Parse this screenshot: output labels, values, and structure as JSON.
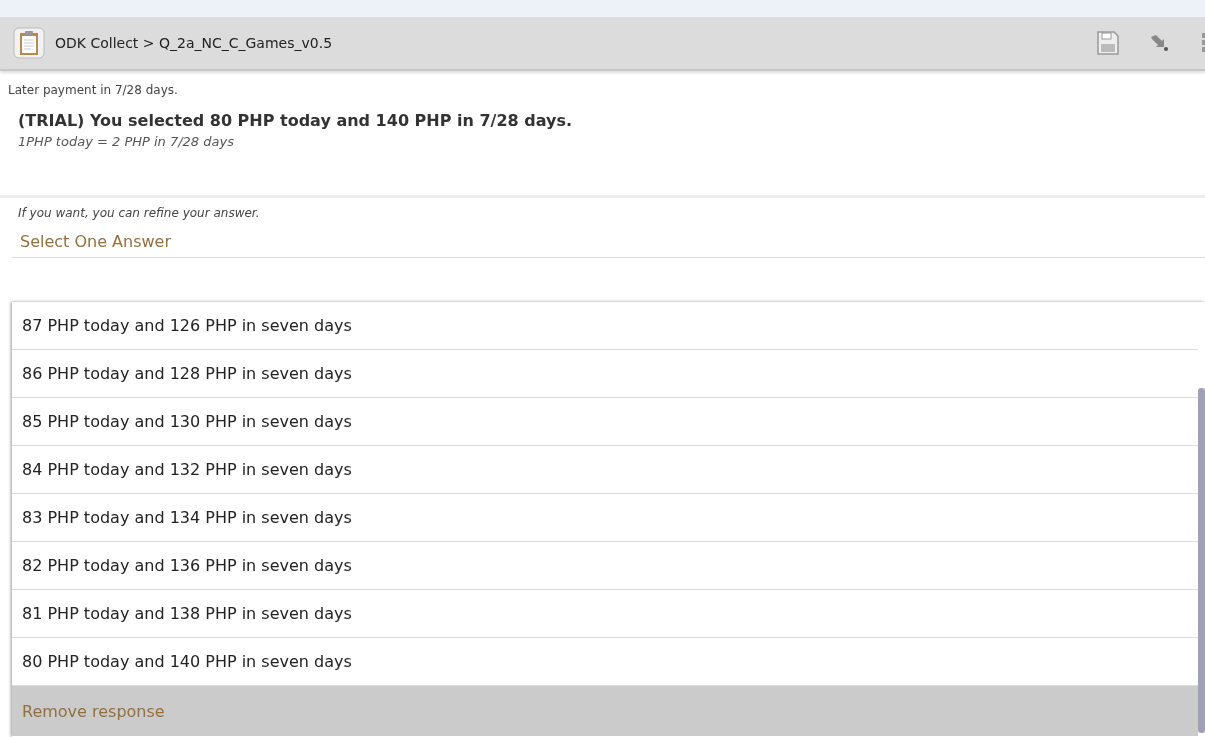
{
  "action_bar": {
    "title": "ODK Collect > Q_2a_NC_C_Games_v0.5"
  },
  "previous_label": "Later payment in 7/28 days.",
  "question": {
    "title": "(TRIAL) You selected 80 PHP today and 140 PHP in 7/28 days.",
    "hint": "1PHP today = 2 PHP in 7/28 days"
  },
  "refine_hint": "If you want, you can refine your answer.",
  "dropdown_prompt": "Select One Answer",
  "options": [
    {
      "label": "87 PHP today and 126 PHP in seven days"
    },
    {
      "label": "86 PHP today and 128 PHP in seven days"
    },
    {
      "label": "85 PHP today and 130 PHP in seven days"
    },
    {
      "label": "84 PHP today and 132 PHP in seven days"
    },
    {
      "label": "83 PHP today and 134 PHP in seven days"
    },
    {
      "label": "82 PHP today and 136 PHP in seven days"
    },
    {
      "label": "81 PHP today and 138 PHP in seven days"
    },
    {
      "label": "80 PHP today and 140 PHP in seven days"
    }
  ],
  "remove_button": "Remove response"
}
